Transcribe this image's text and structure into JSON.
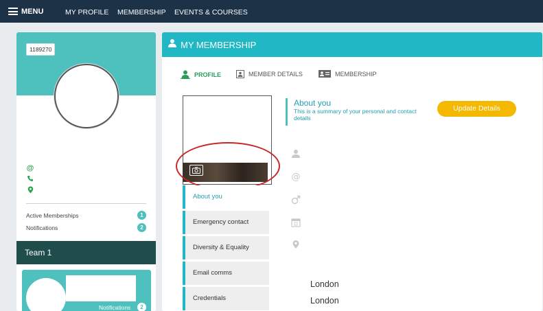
{
  "nav": {
    "menu_label": "MENU",
    "links": [
      "MY PROFILE",
      "MEMBERSHIP",
      "EVENTS & COURSES"
    ]
  },
  "profile_card": {
    "member_id": "1189270",
    "stats": [
      {
        "label": "Active Memberships",
        "count": "1"
      },
      {
        "label": "Notifications",
        "count": "2"
      }
    ],
    "team_name": "Team 1",
    "team_notifications_label": "Notifications",
    "team_notifications_count": "2"
  },
  "main": {
    "title": "MY MEMBERSHIP",
    "tabs": [
      "PROFILE",
      "MEMBER DETAILS",
      "MEMBERSHIP"
    ],
    "about_title": "About you",
    "about_subtitle": "This is a summary of your personal and contact details",
    "update_button": "Update Details",
    "side_nav": [
      "About you",
      "Emergency contact",
      "Diversity & Equality",
      "Email comms",
      "Credentials"
    ],
    "cities": [
      "London",
      "London"
    ]
  },
  "colors": {
    "nav_bg": "#1d3147",
    "teal": "#4ec0bd",
    "header_teal": "#1fb8c4",
    "update_yellow": "#f5b800",
    "active_green": "#2a9d5c",
    "annotation_red": "#c62828"
  }
}
